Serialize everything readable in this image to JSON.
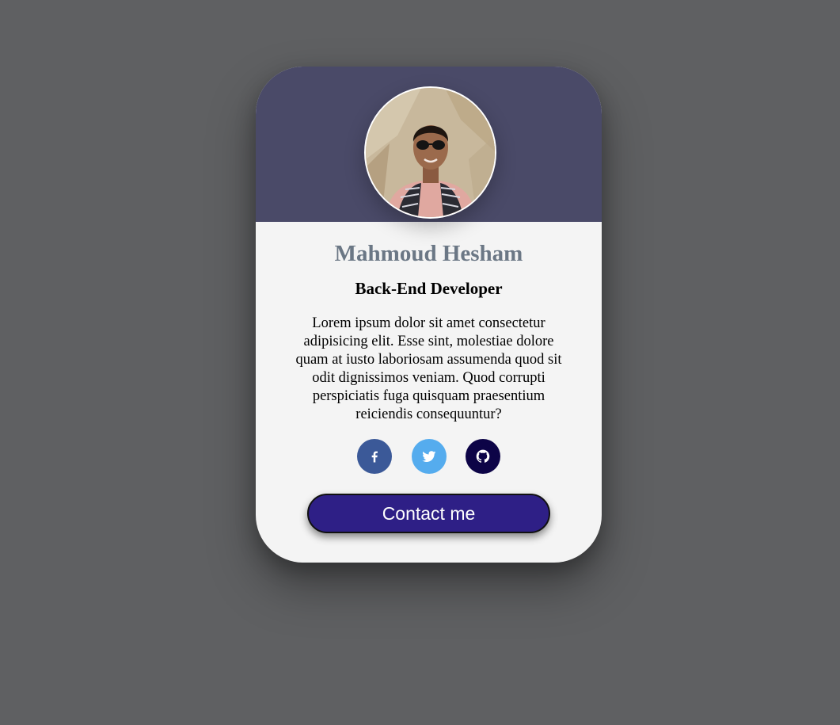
{
  "profile": {
    "name": "Mahmoud Hesham",
    "role": "Back-End Developer",
    "bio": "Lorem ipsum dolor sit amet consectetur adipisicing elit. Esse sint, molestiae dolore quam at iusto laboriosam assumenda quod sit odit dignissimos veniam. Quod corrupti perspiciatis fuga quisquam praesentium reiciendis consequuntur?"
  },
  "socials": [
    {
      "icon": "facebook-icon",
      "color": "#3b5998"
    },
    {
      "icon": "twitter-icon",
      "color": "#55acee"
    },
    {
      "icon": "github-icon",
      "color": "#0d0447"
    }
  ],
  "contact_button": {
    "label": "Contact me",
    "color": "#2e1f86"
  },
  "colors": {
    "background": "#5f6062",
    "header": "#4a4a68",
    "card": "#f4f4f4",
    "name": "#6b7785"
  }
}
